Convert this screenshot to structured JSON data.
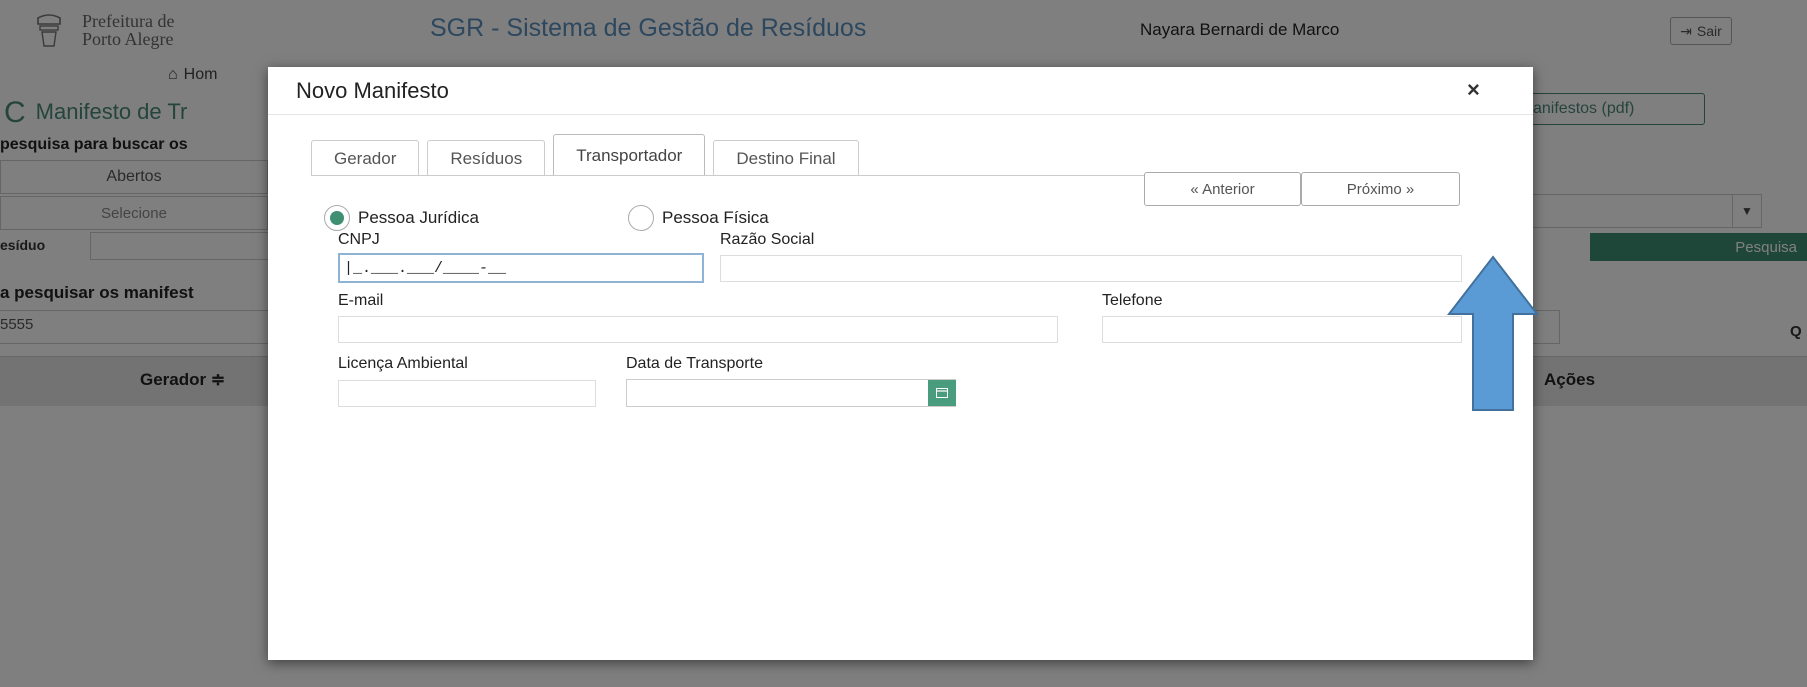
{
  "header": {
    "logo_line1": "Prefeitura de",
    "logo_line2": "Porto Alegre",
    "app_title": "SGR - Sistema de Gestão de Resíduos",
    "user_name": "Nayara Bernardi de Marco",
    "logout_label": "Sair"
  },
  "background": {
    "home_label": "Hom",
    "page_title": "Manifesto de Tr",
    "pdf_button": "anifestos (pdf)",
    "search_instruction": "pesquisa para buscar os",
    "status_filter": "Abertos",
    "select_placeholder": "Selecione",
    "residuo_label": "esíduo",
    "search_button": "Pesquisa",
    "manifest_instruction": "a pesquisar os manifest",
    "search_value": "5555",
    "right_label": "Q",
    "col_gerador": "Gerador ≑",
    "col_acoes": "Ações"
  },
  "modal": {
    "title": "Novo Manifesto",
    "close_glyph": "×",
    "tabs": [
      {
        "label": "Gerador",
        "active": false
      },
      {
        "label": "Resíduos",
        "active": false
      },
      {
        "label": "Transportador",
        "active": true
      },
      {
        "label": "Destino Final",
        "active": false
      }
    ],
    "prev_button": "« Anterior",
    "next_button": "Próximo »",
    "person_type": {
      "juridica_label": "Pessoa Jurídica",
      "fisica_label": "Pessoa Física",
      "selected": "juridica"
    },
    "fields": {
      "cnpj_label": "CNPJ",
      "cnpj_value": "|_.___.___/____-__",
      "razao_social_label": "Razão Social",
      "email_label": "E-mail",
      "telefone_label": "Telefone",
      "licenca_label": "Licença Ambiental",
      "data_transporte_label": "Data de Transporte"
    }
  },
  "colors": {
    "brand_blue": "#5a8fbd",
    "brand_green": "#3f8f72",
    "arrow_fill": "#5b9bd5",
    "arrow_stroke": "#41719c"
  },
  "annotation": {
    "arrow_icon": "up-arrow-icon"
  }
}
